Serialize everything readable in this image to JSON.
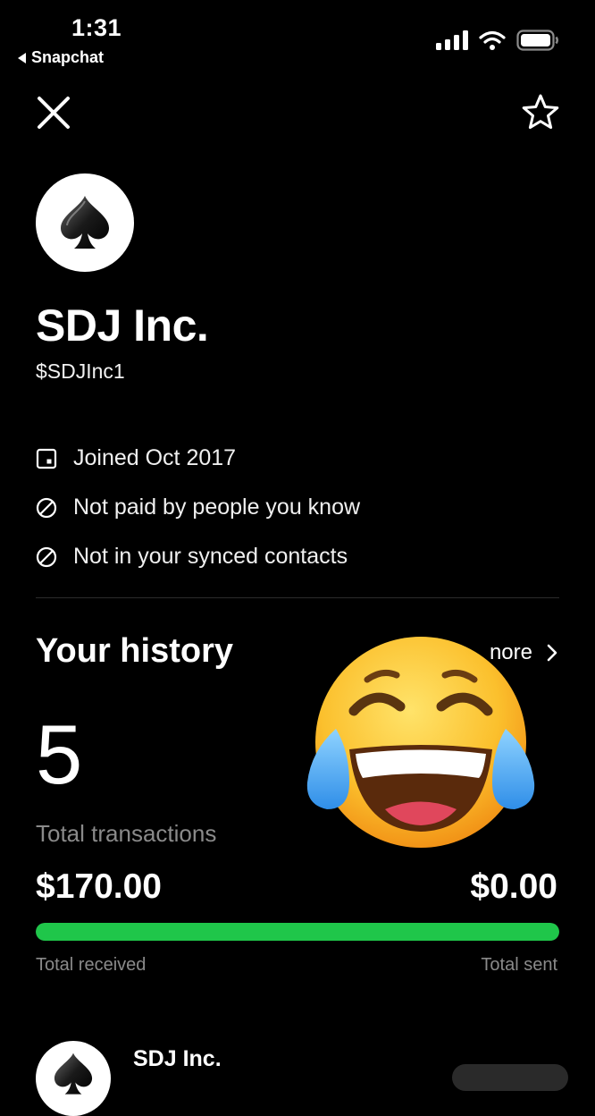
{
  "status_bar": {
    "time": "1:31",
    "back_app": "Snapchat"
  },
  "profile": {
    "name": "SDJ Inc.",
    "handle": "$SDJInc1",
    "info": [
      {
        "icon": "calendar-square-icon",
        "text": "Joined Oct 2017"
      },
      {
        "icon": "prohibited-icon",
        "text": "Not paid by people you know"
      },
      {
        "icon": "prohibited-icon",
        "text": "Not in your synced contacts"
      }
    ]
  },
  "history": {
    "title": "Your history",
    "see_more_label": "nore",
    "count": "5",
    "count_label": "Total transactions",
    "received_amount": "$170.00",
    "sent_amount": "$0.00",
    "received_fraction": 1.0,
    "received_label": "Total received",
    "sent_label": "Total sent"
  },
  "bottom": {
    "name": "SDJ Inc."
  },
  "overlay": {
    "emoji": "face-with-tears-of-joy"
  },
  "colors": {
    "background": "#000000",
    "accent_green": "#1fc64a",
    "muted_text": "#8a8a8a"
  }
}
